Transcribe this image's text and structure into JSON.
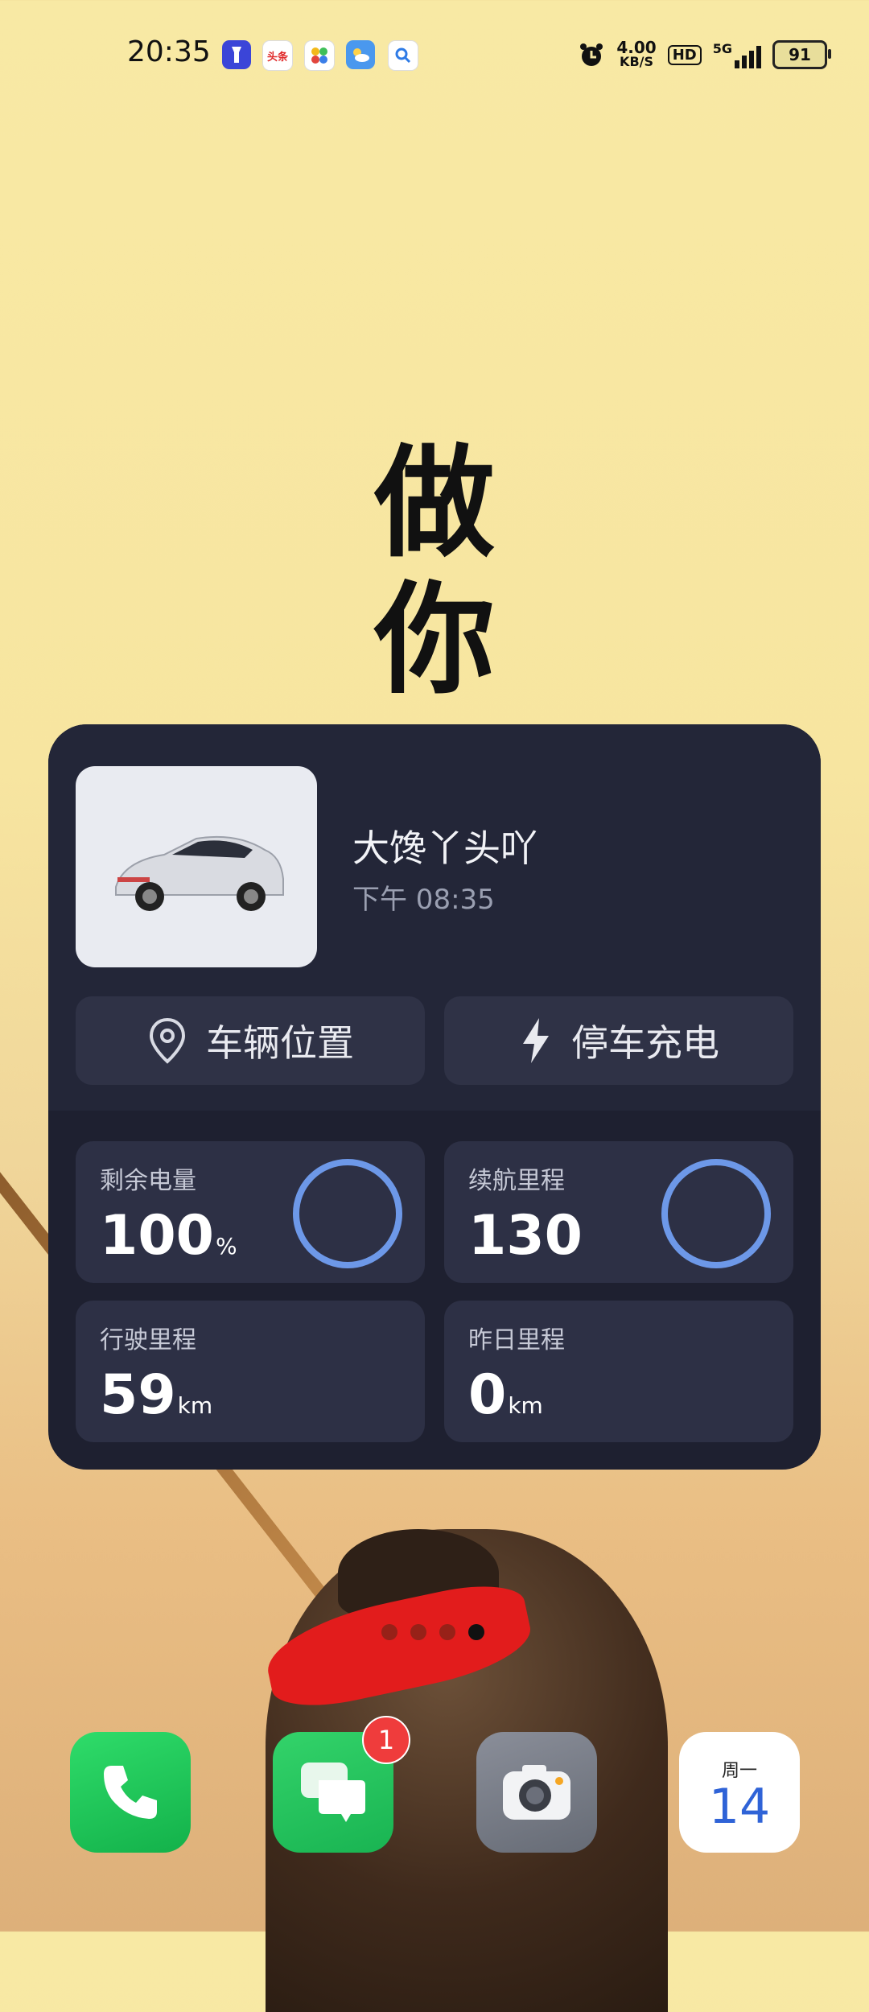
{
  "status_bar": {
    "time": "20:35",
    "net_speed_value": "4.00",
    "net_speed_unit": "KB/S",
    "hd_label": "HD",
    "signal_label": "5G",
    "battery_level": "91",
    "notification_icons": [
      "flashlight-icon",
      "toutiao-icon",
      "apps-icon",
      "weather-icon",
      "search-icon"
    ],
    "toutiao_text": "头条"
  },
  "wallpaper": {
    "calligraphy_line1": "做",
    "calligraphy_line2": "你"
  },
  "car_widget": {
    "car_name": "大馋丫头吖",
    "update_time": "下午 08:35",
    "buttons": {
      "location": "车辆位置",
      "charge": "停车充电"
    },
    "stats": {
      "battery": {
        "label": "剩余电量",
        "value": "100",
        "unit": "%"
      },
      "range": {
        "label": "续航里程",
        "value": "130",
        "unit": ""
      },
      "driven": {
        "label": "行驶里程",
        "value": "59",
        "unit": "km"
      },
      "yesterday": {
        "label": "昨日里程",
        "value": "0",
        "unit": "km"
      }
    },
    "ring_color": "#6d98e8"
  },
  "page_indicator": {
    "count": 4,
    "active_index": 3
  },
  "dock": {
    "phone": "phone-icon",
    "messages_badge": "1",
    "calendar_weekday": "周一",
    "calendar_day": "14"
  }
}
